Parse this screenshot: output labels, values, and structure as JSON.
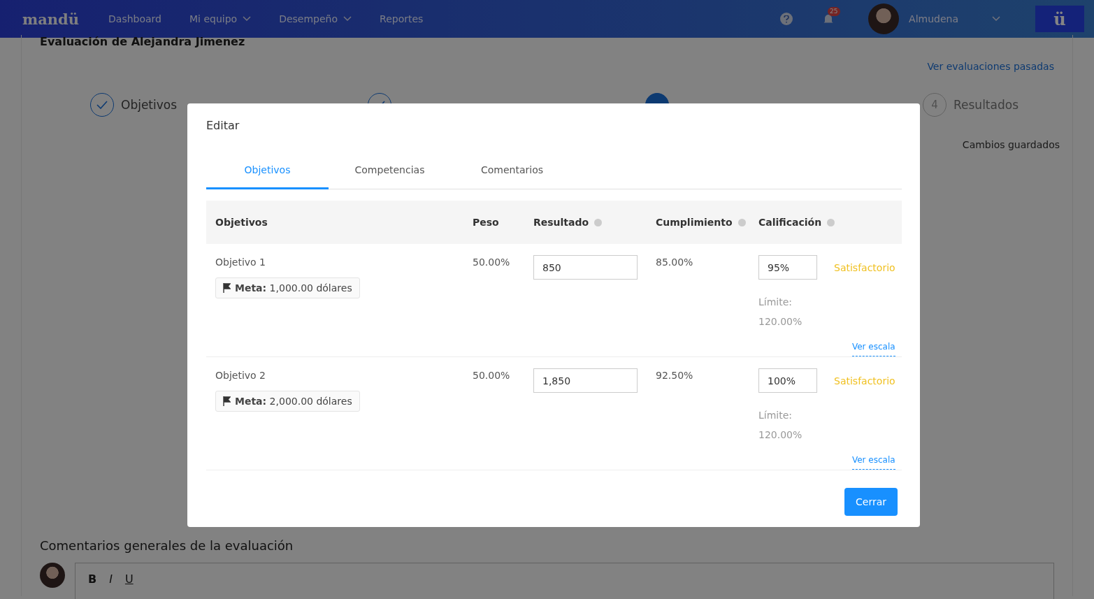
{
  "nav": {
    "logo": "mandü",
    "items": [
      {
        "label": "Dashboard",
        "has_menu": false
      },
      {
        "label": "Mi equipo",
        "has_menu": true
      },
      {
        "label": "Desempeño",
        "has_menu": true
      },
      {
        "label": "Reportes",
        "has_menu": false
      }
    ],
    "notifications": "25",
    "user": "Almudena",
    "brand_button": "ü"
  },
  "page": {
    "title": "Evaluación de Alejandra Jimenez",
    "past_link": "Ver evaluaciones pasadas",
    "steps": [
      {
        "kind": "done",
        "label": "Objetivos"
      },
      {
        "kind": "done"
      },
      {
        "kind": "current"
      },
      {
        "kind": "pending",
        "number": "4",
        "label": "Resultados"
      }
    ],
    "saved": "Cambios guardados",
    "comments_title": "Comentarios generales de la evaluación",
    "editor_tools": [
      "B",
      "I",
      "U"
    ]
  },
  "modal": {
    "title": "Editar",
    "tabs": [
      {
        "label": "Objetivos",
        "selected": true
      },
      {
        "label": "Competencias",
        "selected": false
      },
      {
        "label": "Comentarios",
        "selected": false
      }
    ],
    "columns": [
      {
        "label": "Objetivos",
        "help": false
      },
      {
        "label": "Peso",
        "help": false
      },
      {
        "label": "Resultado",
        "help": true
      },
      {
        "label": "Cumplimiento",
        "help": true
      },
      {
        "label": "Calificación",
        "help": true
      }
    ],
    "rows": [
      {
        "name": "Objetivo 1",
        "goal": "**Meta:** 1,000.00 dólares",
        "weight": "50.00%",
        "result": "850",
        "compliance": "85.00%",
        "rating": "95%",
        "rating_label": "Satisfactorio",
        "limit_label": "Límite:",
        "limit": "120.00%",
        "scale_link": "Ver escala"
      },
      {
        "name": "Objetivo 2",
        "goal": "**Meta:** 2,000.00 dólares",
        "weight": "50.00%",
        "result": "1,850",
        "compliance": "92.50%",
        "rating": "100%",
        "rating_label": "Satisfactorio",
        "limit_label": "Límite:",
        "limit": "120.00%",
        "scale_link": "Ver escala"
      }
    ],
    "close_button": "Cerrar"
  }
}
